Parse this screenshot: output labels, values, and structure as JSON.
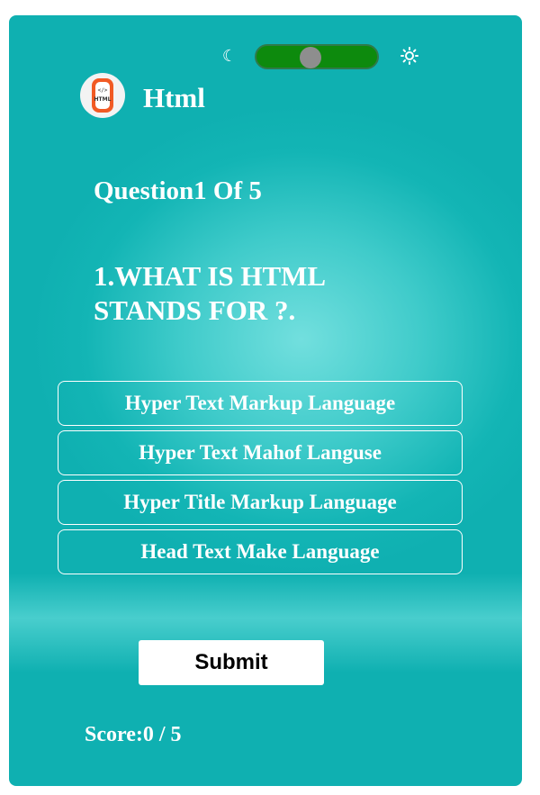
{
  "quiz": {
    "title": "Html",
    "counter": "Question1 Of 5",
    "question": "1.WHAT IS HTML STANDS FOR ?.",
    "options": [
      "Hyper Text Markup Language",
      "Hyper Text Mahof Languse",
      "Hyper Title Markup Language",
      "Head Text Make Language"
    ],
    "submit_label": "Submit",
    "score": "Score:0 / 5"
  },
  "logo": {
    "code_glyph": "</>",
    "text": "HTML"
  },
  "theme_toggle": {
    "left_icon": "moon-icon",
    "right_icon": "sun-icon"
  },
  "colors": {
    "card_bg": "#13b5b5",
    "toggle_track": "#0d8a0d",
    "toggle_knob": "#8e8e8e",
    "logo_orange": "#f15a24",
    "text": "#ffffff",
    "submit_bg": "#ffffff"
  }
}
